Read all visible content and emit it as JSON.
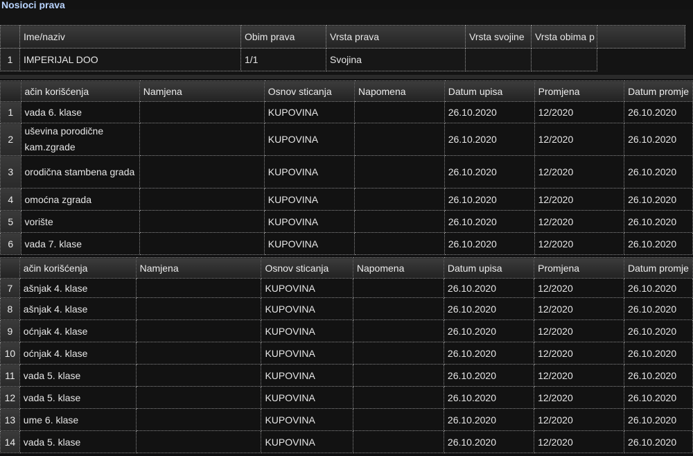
{
  "title": "Nosioci prava",
  "owners": {
    "headers": [
      "Ime/naziv",
      "Obim prava",
      "Vrsta prava",
      "Vrsta svojine",
      "Vrsta obima p"
    ],
    "rows": [
      {
        "n": "1",
        "name": "IMPERIJAL DOO",
        "obim": "1/1",
        "vrsta": "Svojina",
        "svojine": "",
        "obima": ""
      }
    ]
  },
  "table1": {
    "headers": [
      "ačin korišćenja",
      "Namjena",
      "Osnov sticanja",
      "Napomena",
      "Datum upisa",
      "Promjena",
      "Datum promje"
    ],
    "rows": [
      {
        "n": "1",
        "nacin": "vada 6. klase",
        "namjena": "",
        "osnov": "KUPOVINA",
        "napomena": "",
        "datum": "26.10.2020",
        "promjena": "12/2020",
        "datum_promjene": "26.10.2020"
      },
      {
        "n": "2",
        "nacin": "uševina porodične kam.zgrade",
        "namjena": "",
        "osnov": "KUPOVINA",
        "napomena": "",
        "datum": "26.10.2020",
        "promjena": "12/2020",
        "datum_promjene": "26.10.2020"
      },
      {
        "n": "3",
        "nacin": "orodična stambena grada",
        "namjena": "",
        "osnov": "KUPOVINA",
        "napomena": "",
        "datum": "26.10.2020",
        "promjena": "12/2020",
        "datum_promjene": "26.10.2020"
      },
      {
        "n": "4",
        "nacin": "omoćna zgrada",
        "namjena": "",
        "osnov": "KUPOVINA",
        "napomena": "",
        "datum": "26.10.2020",
        "promjena": "12/2020",
        "datum_promjene": "26.10.2020"
      },
      {
        "n": "5",
        "nacin": "vorište",
        "namjena": "",
        "osnov": "KUPOVINA",
        "napomena": "",
        "datum": "26.10.2020",
        "promjena": "12/2020",
        "datum_promjene": "26.10.2020"
      },
      {
        "n": "6",
        "nacin": "vada 7. klase",
        "namjena": "",
        "osnov": "KUPOVINA",
        "napomena": "",
        "datum": "26.10.2020",
        "promjena": "12/2020",
        "datum_promjene": "26.10.2020"
      }
    ]
  },
  "table2": {
    "headers": [
      "ačin korišćenja",
      "Namjena",
      "Osnov sticanja",
      "Napomena",
      "Datum upisa",
      "Promjena",
      "Datum promje"
    ],
    "rows": [
      {
        "n": "7",
        "nacin": "ašnjak 4. klase",
        "namjena": "",
        "osnov": "KUPOVINA",
        "napomena": "",
        "datum": "26.10.2020",
        "promjena": "12/2020",
        "datum_promjene": "26.10.2020"
      },
      {
        "n": "8",
        "nacin": "ašnjak 4. klase",
        "namjena": "",
        "osnov": "KUPOVINA",
        "napomena": "",
        "datum": "26.10.2020",
        "promjena": "12/2020",
        "datum_promjene": "26.10.2020"
      },
      {
        "n": "9",
        "nacin": "oćnjak 4. klase",
        "namjena": "",
        "osnov": "KUPOVINA",
        "napomena": "",
        "datum": "26.10.2020",
        "promjena": "12/2020",
        "datum_promjene": "26.10.2020"
      },
      {
        "n": "10",
        "nacin": "oćnjak 4. klase",
        "namjena": "",
        "osnov": "KUPOVINA",
        "napomena": "",
        "datum": "26.10.2020",
        "promjena": "12/2020",
        "datum_promjene": "26.10.2020"
      },
      {
        "n": "11",
        "nacin": "vada 5. klase",
        "namjena": "",
        "osnov": "KUPOVINA",
        "napomena": "",
        "datum": "26.10.2020",
        "promjena": "12/2020",
        "datum_promjene": "26.10.2020"
      },
      {
        "n": "12",
        "nacin": "vada 5. klase",
        "namjena": "",
        "osnov": "KUPOVINA",
        "napomena": "",
        "datum": "26.10.2020",
        "promjena": "12/2020",
        "datum_promjene": "26.10.2020"
      },
      {
        "n": "13",
        "nacin": "ume 6. klase",
        "namjena": "",
        "osnov": "KUPOVINA",
        "napomena": "",
        "datum": "26.10.2020",
        "promjena": "12/2020",
        "datum_promjene": "26.10.2020"
      },
      {
        "n": "14",
        "nacin": "vada 5. klase",
        "namjena": "",
        "osnov": "KUPOVINA",
        "napomena": "",
        "datum": "26.10.2020",
        "promjena": "12/2020",
        "datum_promjene": "26.10.2020"
      }
    ]
  }
}
